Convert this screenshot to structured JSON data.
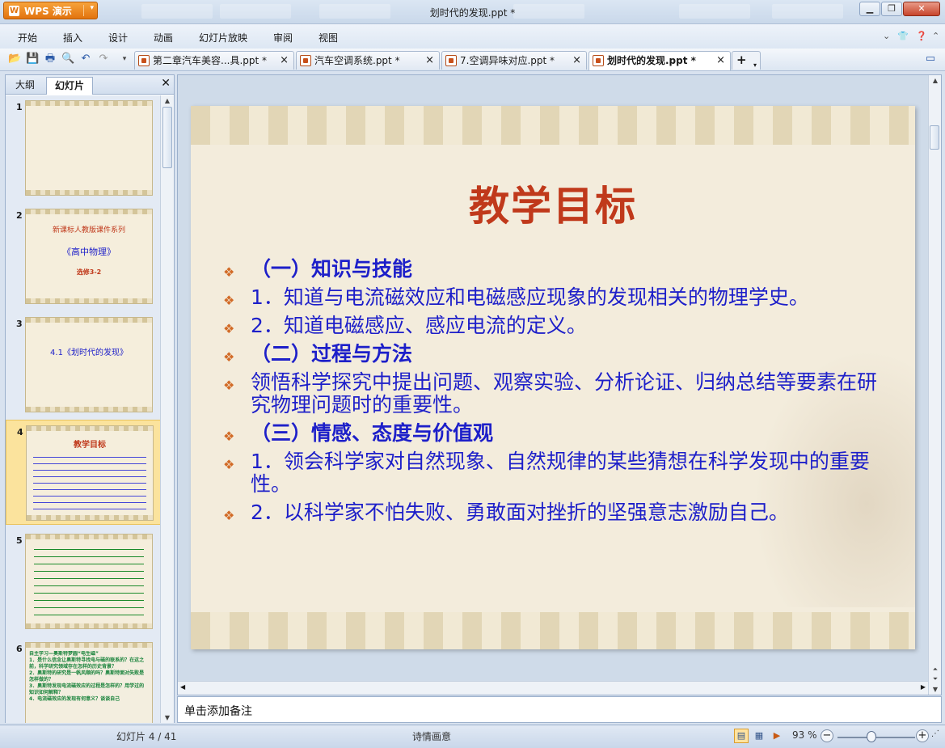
{
  "app": {
    "button_label": "WPS 演示",
    "window_title": "划时代的发现.ppt *"
  },
  "menu": [
    "开始",
    "插入",
    "设计",
    "动画",
    "幻灯片放映",
    "审阅",
    "视图"
  ],
  "doc_tabs": [
    {
      "label": "第二章汽车美容...具.ppt *",
      "active": false
    },
    {
      "label": "汽车空调系统.ppt *",
      "active": false
    },
    {
      "label": "7.空调异味对应.ppt *",
      "active": false
    },
    {
      "label": "划时代的发现.ppt *",
      "active": true
    }
  ],
  "panel": {
    "tab_outline": "大纲",
    "tab_slides": "幻灯片"
  },
  "thumbs": [
    {
      "num": "1"
    },
    {
      "num": "2",
      "line1": "新课标人教版课件系列",
      "line2": "《高中物理》",
      "line3": "选修3-2"
    },
    {
      "num": "3",
      "line1": "4.1《划时代的发现》"
    },
    {
      "num": "4",
      "title": "教学目标"
    },
    {
      "num": "5"
    },
    {
      "num": "6",
      "line1": "自主学习—奥斯特梦圆“电生磁”",
      "line2": "1．是什么信念让奥斯特寻找电与磁的联系的？在这之前，科学研究领域存在怎样的历史背景？",
      "line3": "2．奥斯特的研究是一帆风顺的吗？奥斯特面对失败是怎样做的？",
      "line4": "3．奥斯特发现电流磁效应的过程是怎样的？用学过的知识如何解释？",
      "line5": "4．电流磁效应的发现有何意义？谈谈自己"
    }
  ],
  "slide": {
    "title": "教学目标",
    "bullets": [
      {
        "text": "（一）知识与技能",
        "heading": true
      },
      {
        "text": "1．知道与电流磁效应和电磁感应现象的发现相关的物理学史。",
        "heading": false
      },
      {
        "text": "2．知道电磁感应、感应电流的定义。",
        "heading": false
      },
      {
        "text": "（二）过程与方法",
        "heading": true
      },
      {
        "text": "领悟科学探究中提出问题、观察实验、分析论证、归纳总结等要素在研究物理问题时的重要性。",
        "heading": false
      },
      {
        "text": "（三）情感、态度与价值观",
        "heading": true
      },
      {
        "text": "1．领会科学家对自然现象、自然规律的某些猜想在科学发现中的重要性。",
        "heading": false
      },
      {
        "text": "2．以科学家不怕失败、勇敢面对挫折的坚强意志激励自己。",
        "heading": false
      }
    ]
  },
  "notes_placeholder": "单击添加备注",
  "status": {
    "slide_counter": "幻灯片 4 / 41",
    "theme": "诗情画意",
    "zoom": "93 %",
    "zoom_level": 0.5
  },
  "colors": {
    "title": "#c0391b",
    "bullet_text": "#1d1fc9",
    "bullet_marker": "#d26b27"
  }
}
